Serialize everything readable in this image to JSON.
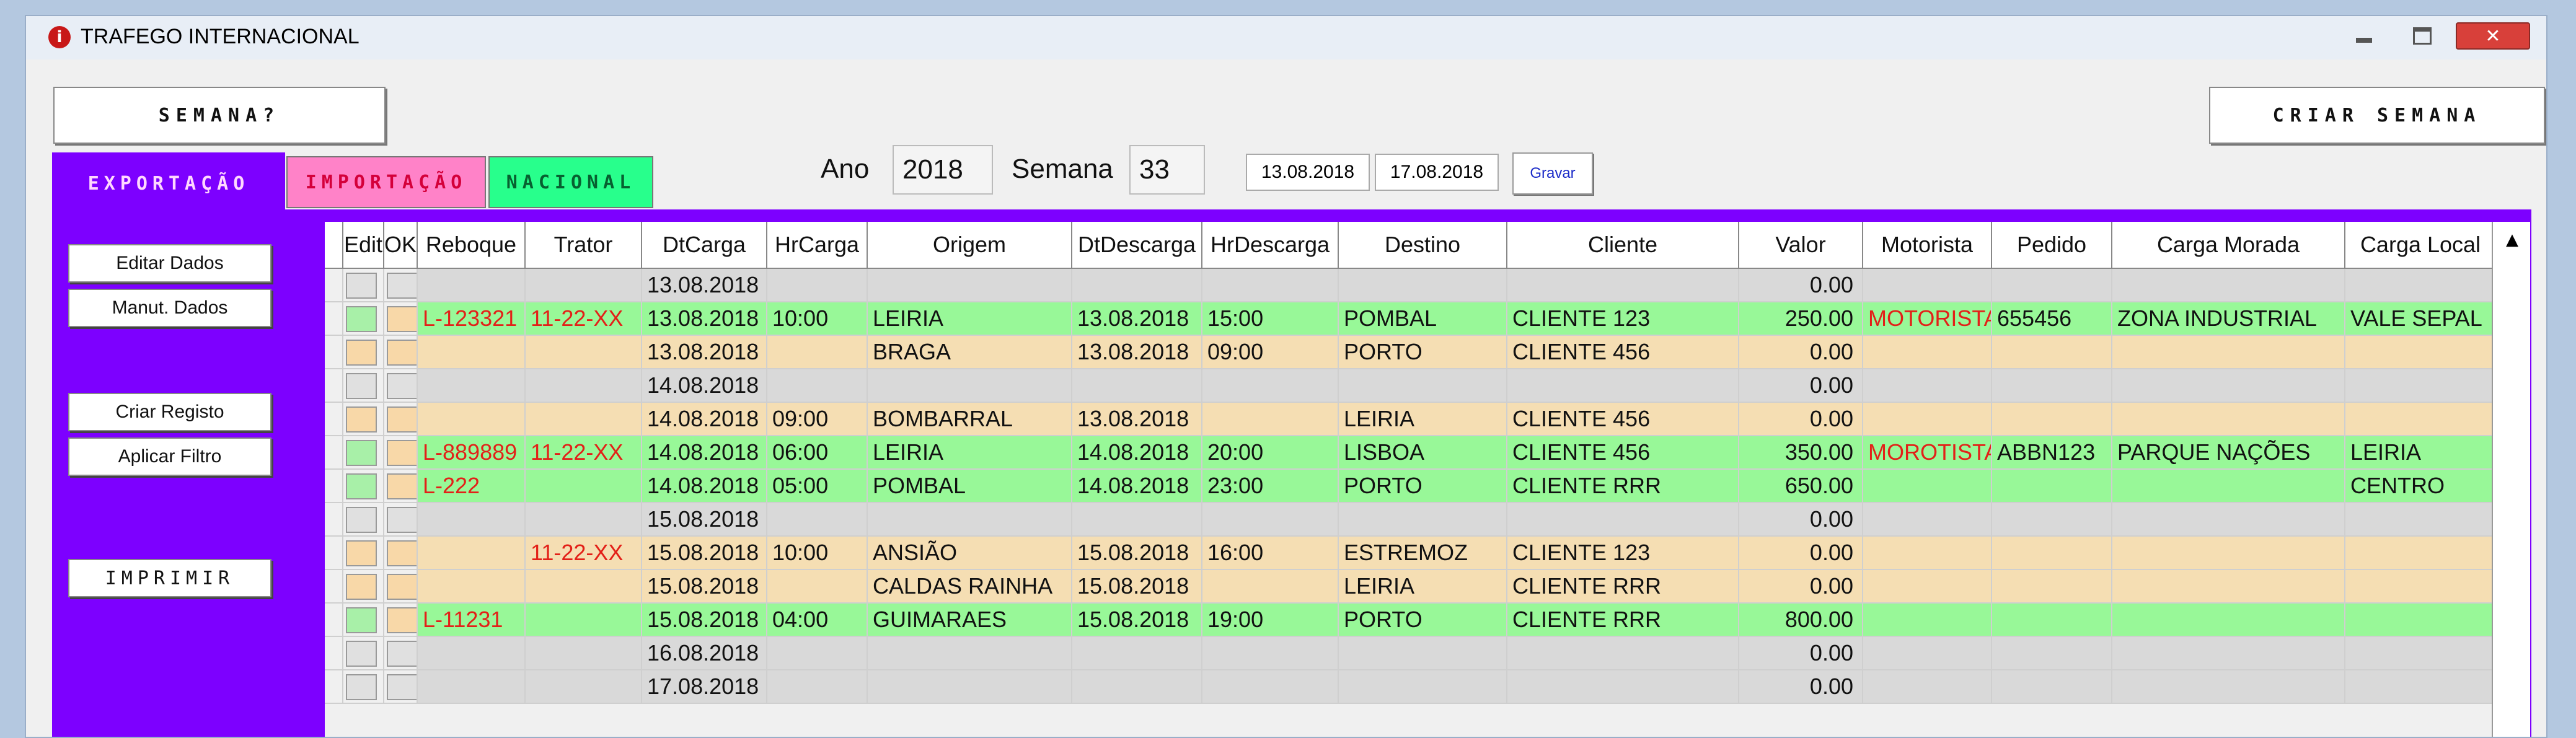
{
  "window": {
    "title": "TRAFEGO INTERNACIONAL"
  },
  "toolbar": {
    "semana_label": "SEMANA?",
    "criar_semana_label": "CRIAR SEMANA",
    "ano_label": "Ano",
    "ano_value": "2018",
    "semana_field_label": "Semana",
    "semana_value": "33",
    "date_from": "13.08.2018",
    "date_to": "17.08.2018",
    "gravar_label": "Gravar"
  },
  "tabs": [
    {
      "label": "EXPORTAÇÃO"
    },
    {
      "label": "IMPORTAÇÃO"
    },
    {
      "label": "NACIONAL"
    }
  ],
  "sidebar": {
    "editar_dados": "Editar Dados",
    "manut_dados": "Manut. Dados",
    "criar_registo": "Criar Registo",
    "aplicar_filtro": "Aplicar Filtro",
    "imprimir": "IMPRIMIR"
  },
  "table": {
    "columns": [
      "Edit",
      "OK",
      "Reboque",
      "Trator",
      "DtCarga",
      "HrCarga",
      "Origem",
      "DtDescarga",
      "HrDescarga",
      "Destino",
      "Cliente",
      "Valor",
      "Motorista",
      "Pedido",
      "Carga Morada",
      "Carga Local"
    ],
    "rows": [
      {
        "status": "empty",
        "reboque": "",
        "trator": "",
        "dtcarga": "13.08.2018",
        "hrcarga": "",
        "origem": "",
        "dtdescarga": "",
        "hrdescarga": "",
        "destino": "",
        "cliente": "",
        "valor": "0.00",
        "motorista": "",
        "pedido": "",
        "carga_morada": "",
        "carga_local": ""
      },
      {
        "status": "assigned",
        "reboque": "L-123321",
        "trator": "11-22-XX",
        "dtcarga": "13.08.2018",
        "hrcarga": "10:00",
        "origem": "LEIRIA",
        "dtdescarga": "13.08.2018",
        "hrdescarga": "15:00",
        "destino": "POMBAL",
        "cliente": "CLIENTE 123",
        "valor": "250.00",
        "motorista": "MOTORISTA",
        "pedido": "655456",
        "carga_morada": "ZONA INDUSTRIAL",
        "carga_local": "VALE SEPAL"
      },
      {
        "status": "pending",
        "reboque": "",
        "trator": "",
        "dtcarga": "13.08.2018",
        "hrcarga": "",
        "origem": "BRAGA",
        "dtdescarga": "13.08.2018",
        "hrdescarga": "09:00",
        "destino": "PORTO",
        "cliente": "CLIENTE 456",
        "valor": "0.00",
        "motorista": "",
        "pedido": "",
        "carga_morada": "",
        "carga_local": ""
      },
      {
        "status": "empty",
        "reboque": "",
        "trator": "",
        "dtcarga": "14.08.2018",
        "hrcarga": "",
        "origem": "",
        "dtdescarga": "",
        "hrdescarga": "",
        "destino": "",
        "cliente": "",
        "valor": "0.00",
        "motorista": "",
        "pedido": "",
        "carga_morada": "",
        "carga_local": ""
      },
      {
        "status": "pending",
        "reboque": "",
        "trator": "",
        "dtcarga": "14.08.2018",
        "hrcarga": "09:00",
        "origem": "BOMBARRAL",
        "dtdescarga": "13.08.2018",
        "hrdescarga": "",
        "destino": "LEIRIA",
        "cliente": "CLIENTE 456",
        "valor": "0.00",
        "motorista": "",
        "pedido": "",
        "carga_morada": "",
        "carga_local": ""
      },
      {
        "status": "assigned",
        "reboque": "L-889889",
        "trator": "11-22-XX",
        "dtcarga": "14.08.2018",
        "hrcarga": "06:00",
        "origem": "LEIRIA",
        "dtdescarga": "14.08.2018",
        "hrdescarga": "20:00",
        "destino": "LISBOA",
        "cliente": "CLIENTE 456",
        "valor": "350.00",
        "motorista": "MOROTISTA",
        "pedido": "ABBN123",
        "carga_morada": "PARQUE NAÇÕES",
        "carga_local": "LEIRIA"
      },
      {
        "status": "assigned",
        "reboque": "L-222",
        "trator": "",
        "dtcarga": "14.08.2018",
        "hrcarga": "05:00",
        "origem": "POMBAL",
        "dtdescarga": "14.08.2018",
        "hrdescarga": "23:00",
        "destino": "PORTO",
        "cliente": "CLIENTE RRR",
        "valor": "650.00",
        "motorista": "",
        "pedido": "",
        "carga_morada": "",
        "carga_local": "CENTRO"
      },
      {
        "status": "empty",
        "reboque": "",
        "trator": "",
        "dtcarga": "15.08.2018",
        "hrcarga": "",
        "origem": "",
        "dtdescarga": "",
        "hrdescarga": "",
        "destino": "",
        "cliente": "",
        "valor": "0.00",
        "motorista": "",
        "pedido": "",
        "carga_morada": "",
        "carga_local": ""
      },
      {
        "status": "pending",
        "reboque": "",
        "trator": "11-22-XX",
        "dtcarga": "15.08.2018",
        "hrcarga": "10:00",
        "origem": "ANSIÃO",
        "dtdescarga": "15.08.2018",
        "hrdescarga": "16:00",
        "destino": "ESTREMOZ",
        "cliente": "CLIENTE 123",
        "valor": "0.00",
        "motorista": "",
        "pedido": "",
        "carga_morada": "",
        "carga_local": ""
      },
      {
        "status": "pending",
        "reboque": "",
        "trator": "",
        "dtcarga": "15.08.2018",
        "hrcarga": "",
        "origem": "CALDAS RAINHA",
        "dtdescarga": "15.08.2018",
        "hrdescarga": "",
        "destino": "LEIRIA",
        "cliente": "CLIENTE RRR",
        "valor": "0.00",
        "motorista": "",
        "pedido": "",
        "carga_morada": "",
        "carga_local": ""
      },
      {
        "status": "assigned",
        "reboque": "L-11231",
        "trator": "",
        "dtcarga": "15.08.2018",
        "hrcarga": "04:00",
        "origem": "GUIMARAES",
        "dtdescarga": "15.08.2018",
        "hrdescarga": "19:00",
        "destino": "PORTO",
        "cliente": "CLIENTE RRR",
        "valor": "800.00",
        "motorista": "",
        "pedido": "",
        "carga_morada": "",
        "carga_local": ""
      },
      {
        "status": "empty",
        "reboque": "",
        "trator": "",
        "dtcarga": "16.08.2018",
        "hrcarga": "",
        "origem": "",
        "dtdescarga": "",
        "hrdescarga": "",
        "destino": "",
        "cliente": "",
        "valor": "0.00",
        "motorista": "",
        "pedido": "",
        "carga_morada": "",
        "carga_local": ""
      },
      {
        "status": "empty",
        "reboque": "",
        "trator": "",
        "dtcarga": "17.08.2018",
        "hrcarga": "",
        "origem": "",
        "dtdescarga": "",
        "hrdescarga": "",
        "destino": "",
        "cliente": "",
        "valor": "0.00",
        "motorista": "",
        "pedido": "",
        "carga_morada": "",
        "carga_local": ""
      }
    ]
  },
  "colors": {
    "panel": "#7d00ff",
    "row_empty": "#d9d9d9",
    "row_assigned": "#98f898",
    "row_pending": "#f5deb3",
    "text_red": "#e32018",
    "chk_empty": "#e0e0e0",
    "chk_assigned": "#a8f0a8",
    "chk_pending": "#f8d8a8"
  },
  "icons": {
    "app": "info-icon",
    "minimize": "minimize-icon",
    "maximize": "maximize-icon",
    "close": "close-icon",
    "scroll_up": "arrow-up-icon"
  }
}
